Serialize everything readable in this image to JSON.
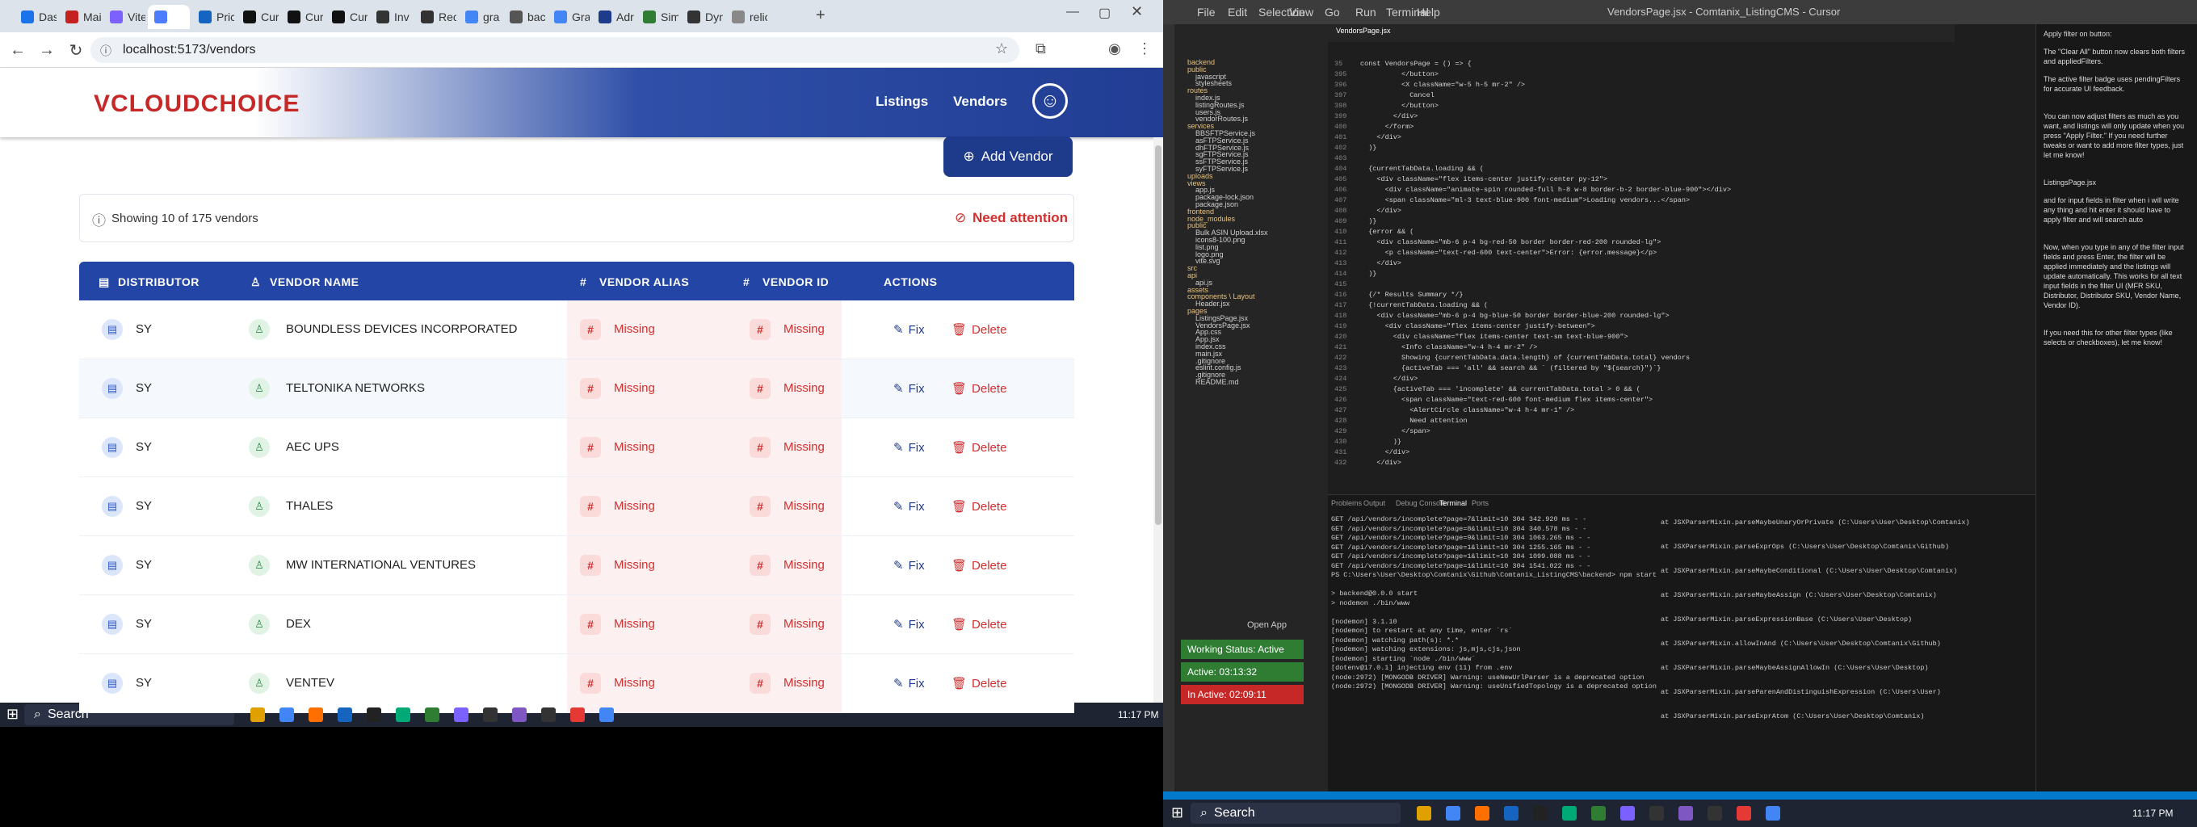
{
  "browser": {
    "tabs": [
      "Das",
      "Mai",
      "Vite",
      "",
      "Pric",
      "Curs",
      "Curs",
      "Curs",
      "Inv",
      "Rec",
      "gra",
      "bac",
      "Gra",
      "Adr",
      "Sim",
      "Dyn",
      "relic"
    ],
    "url": "localhost:5173/vendors"
  },
  "app": {
    "logo": "VCLOUDCHOICE",
    "nav": {
      "listings": "Listings",
      "vendors": "Vendors"
    },
    "add_vendor": "Add Vendor",
    "summary": "Showing 10 of 175 vendors",
    "need_attention": "Need attention",
    "columns": [
      "DISTRIBUTOR",
      "VENDOR NAME",
      "VENDOR ALIAS",
      "VENDOR ID",
      "ACTIONS"
    ],
    "rows": [
      {
        "distributor": "SY",
        "vendor": "BOUNDLESS DEVICES INCORPORATED",
        "alias": "Missing",
        "id": "Missing"
      },
      {
        "distributor": "SY",
        "vendor": "TELTONIKA NETWORKS",
        "alias": "Missing",
        "id": "Missing"
      },
      {
        "distributor": "SY",
        "vendor": "AEC UPS",
        "alias": "Missing",
        "id": "Missing"
      },
      {
        "distributor": "SY",
        "vendor": "THALES",
        "alias": "Missing",
        "id": "Missing"
      },
      {
        "distributor": "SY",
        "vendor": "MW INTERNATIONAL VENTURES",
        "alias": "Missing",
        "id": "Missing"
      },
      {
        "distributor": "SY",
        "vendor": "DEX",
        "alias": "Missing",
        "id": "Missing"
      },
      {
        "distributor": "SY",
        "vendor": "VENTEV",
        "alias": "Missing",
        "id": "Missing"
      }
    ],
    "fix_label": "Fix",
    "delete_label": "Delete"
  },
  "taskbar": {
    "search": "Search",
    "clock_left": "11:17 PM",
    "clock_right": "11:17 PM"
  },
  "vscode": {
    "title": "VendorsPage.jsx - Comtanix_ListingCMS - Cursor",
    "menus": [
      "File",
      "Edit",
      "Selection",
      "View",
      "Go",
      "Run",
      "Terminal",
      "Help"
    ],
    "open_tab": "VendorsPage.jsx",
    "tree": [
      "backend",
      "public",
      "javascript",
      "stylesheets",
      "routes",
      "index.js",
      "listingRoutes.js",
      "users.js",
      "vendorRoutes.js",
      "services",
      "BBSFTPService.js",
      "asFTPService.js",
      "dhFTPService.js",
      "sgFTPService.js",
      "ssFTPService.js",
      "syFTPService.js",
      "uploads",
      "views",
      "app.js",
      "package-lock.json",
      "package.json",
      "frontend",
      "node_modules",
      "public",
      "Bulk ASIN Upload.xlsx",
      "icons8-100.png",
      "list.png",
      "logo.png",
      "vite.svg",
      "src",
      "api",
      "api.js",
      "assets",
      "components \\ Layout",
      "Header.jsx",
      "pages",
      "ListingsPage.jsx",
      "VendorsPage.jsx",
      "App.css",
      "App.jsx",
      "index.css",
      "main.jsx",
      ".gitignore",
      "eslint.config.js",
      ".gitignore",
      "README.md"
    ],
    "code_lines": [
      [
        "35",
        "const VendorsPage = () => {"
      ],
      [
        "395",
        "          </button>"
      ],
      [
        "396",
        "          <X className=\"w-5 h-5 mr-2\" />"
      ],
      [
        "397",
        "            Cancel"
      ],
      [
        "398",
        "          </button>"
      ],
      [
        "399",
        "        </div>"
      ],
      [
        "400",
        "      </form>"
      ],
      [
        "401",
        "    </div>"
      ],
      [
        "402",
        "  )}"
      ],
      [
        "403",
        ""
      ],
      [
        "404",
        "  {currentTabData.loading && ("
      ],
      [
        "405",
        "    <div className=\"flex items-center justify-center py-12\">"
      ],
      [
        "406",
        "      <div className=\"animate-spin rounded-full h-8 w-8 border-b-2 border-blue-900\"></div>"
      ],
      [
        "407",
        "      <span className=\"ml-3 text-blue-900 font-medium\">Loading vendors...</span>"
      ],
      [
        "408",
        "    </div>"
      ],
      [
        "409",
        "  )}"
      ],
      [
        "410",
        "  {error && ("
      ],
      [
        "411",
        "    <div className=\"mb-6 p-4 bg-red-50 border border-red-200 rounded-lg\">"
      ],
      [
        "412",
        "      <p className=\"text-red-600 text-center\">Error: {error.message}</p>"
      ],
      [
        "413",
        "    </div>"
      ],
      [
        "414",
        "  )}"
      ],
      [
        "415",
        ""
      ],
      [
        "416",
        "  {/* Results Summary */}"
      ],
      [
        "417",
        "  {!currentTabData.loading && ("
      ],
      [
        "418",
        "    <div className=\"mb-6 p-4 bg-blue-50 border border-blue-200 rounded-lg\">"
      ],
      [
        "419",
        "      <div className=\"flex items-center justify-between\">"
      ],
      [
        "420",
        "        <div className=\"flex items-center text-sm text-blue-900\">"
      ],
      [
        "421",
        "          <Info className=\"w-4 h-4 mr-2\" />"
      ],
      [
        "422",
        "          Showing {currentTabData.data.length} of {currentTabData.total} vendors"
      ],
      [
        "423",
        "          {activeTab === 'all' && search && ` (filtered by \"${search}\")`}"
      ],
      [
        "424",
        "        </div>"
      ],
      [
        "425",
        "        {activeTab === 'incomplete' && currentTabData.total > 0 && ("
      ],
      [
        "426",
        "          <span className=\"text-red-600 font-medium flex items-center\">"
      ],
      [
        "427",
        "            <AlertCircle className=\"w-4 h-4 mr-1\" />"
      ],
      [
        "428",
        "            Need attention"
      ],
      [
        "429",
        "          </span>"
      ],
      [
        "430",
        "        )}"
      ],
      [
        "431",
        "      </div>"
      ],
      [
        "432",
        "    </div>"
      ]
    ],
    "panel_tabs": [
      "Problems",
      "Output",
      "Debug Console",
      "Terminal",
      "Ports"
    ],
    "terminal_left": [
      "GET /api/vendors/incomplete?page=7&limit=10 304 342.920 ms - -",
      "GET /api/vendors/incomplete?page=8&limit=10 304 340.578 ms - -",
      "GET /api/vendors/incomplete?page=9&limit=10 304 1063.265 ms - -",
      "GET /api/vendors/incomplete?page=1&limit=10 304 1255.165 ms - -",
      "GET /api/vendors/incomplete?page=1&limit=10 304 1099.088 ms - -",
      "GET /api/vendors/incomplete?page=1&limit=10 304 1541.022 ms - -",
      "PS C:\\Users\\User\\Desktop\\Comtanix\\Github\\Comtanix_ListingCMS\\backend> npm start",
      "",
      "> backend@0.0.0 start",
      "> nodemon ./bin/www",
      "",
      "[nodemon] 3.1.10",
      "[nodemon] to restart at any time, enter `rs`",
      "[nodemon] watching path(s): *.*",
      "[nodemon] watching extensions: js,mjs,cjs,json",
      "[nodemon] starting `node ./bin/www`",
      "[dotenv@17.0.1] injecting env (11) from .env",
      "(node:2972) [MONGODB DRIVER] Warning: useNewUrlParser is a deprecated option",
      "(node:2972) [MONGODB DRIVER] Warning: useUnifiedTopology is a deprecated option"
    ],
    "terminal_right": [
      "at JSXParserMixin.parseMaybeUnaryOrPrivate (C:\\Users\\User\\Desktop\\Comtanix)",
      "at JSXParserMixin.parseExprOps (C:\\Users\\User\\Desktop\\Comtanix\\Github)",
      "at JSXParserMixin.parseMaybeConditional (C:\\Users\\User\\Desktop\\Comtanix)",
      "at JSXParserMixin.parseMaybeAssign (C:\\Users\\User\\Desktop\\Comtanix)",
      "at JSXParserMixin.parseExpressionBase (C:\\Users\\User\\Desktop)",
      "at JSXParserMixin.allowInAnd (C:\\Users\\User\\Desktop\\Comtanix\\Github)",
      "at JSXParserMixin.parseMaybeAssignAllowIn (C:\\Users\\User\\Desktop)",
      "at JSXParserMixin.parseParenAndDistinguishExpression (C:\\Users\\User)",
      "at JSXParserMixin.parseExprAtom (C:\\Users\\User\\Desktop\\Comtanix)"
    ],
    "workspace": {
      "status": "Working Status: Active",
      "active": "Active: 03:13:32",
      "inactive": "In Active: 02:09:11"
    },
    "open_app": "Open App",
    "chat": [
      "Apply filter on button:",
      "The \"Clear All\" button now clears both filters and appliedFilters.",
      "The active filter badge uses pendingFilters for accurate UI feedback.",
      "You can now adjust filters as much as you want, and listings will only update when you press \"Apply Filter.\" If you need further tweaks or want to add more filter types, just let me know!",
      "ListingsPage.jsx",
      "and for input fields in filter when i will write any thing and hit enter it should have to apply filter and will search auto",
      "Now, when you type in any of the filter input fields and press Enter, the filter will be applied immediately and the listings will update automatically. This works for all text input fields in the filter UI (MFR SKU, Distributor, Distributor SKU, Vendor Name, Vendor ID).",
      "If you need this for other filter types (like selects or checkboxes), let me know!"
    ]
  },
  "colors": {
    "brand_blue": "#2346a6",
    "missing_red": "#d32f2f",
    "accent_dark": "#1e3a8a"
  }
}
